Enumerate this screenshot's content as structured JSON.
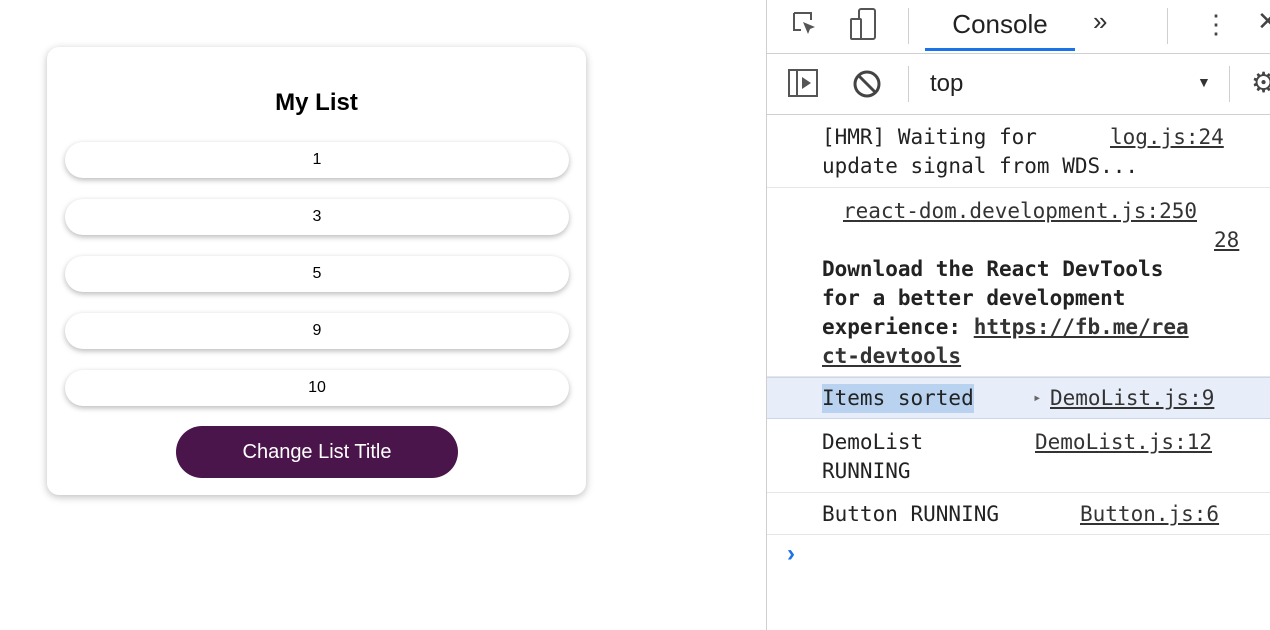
{
  "app": {
    "title": "My List",
    "items": [
      "1",
      "3",
      "5",
      "9",
      "10"
    ],
    "button_label": "Change List Title",
    "accent": "#4a154b"
  },
  "devtools": {
    "tabs": {
      "active": "Console",
      "more": "»",
      "menu": "⋮",
      "close": "✕"
    },
    "context": "top",
    "messages": [
      {
        "text1": "[HMR] Waiting for",
        "text2": "update signal from WDS...",
        "source": "log.js:24"
      },
      {
        "source1": "react-dom.development.js:250",
        "source2": "28",
        "text1": "Download the React DevTools",
        "text2": "for a better development",
        "text3_pre": "experience: ",
        "link1": "https://fb.me/rea",
        "link2": "ct-devtools"
      },
      {
        "text": "Items sorted",
        "source": "DemoList.js:9"
      },
      {
        "text1": "DemoList",
        "text2": "RUNNING",
        "source": "DemoList.js:12"
      },
      {
        "text": "Button RUNNING",
        "source": "Button.js:6"
      }
    ],
    "prompt": "›",
    "accent": "#1a73e8"
  }
}
